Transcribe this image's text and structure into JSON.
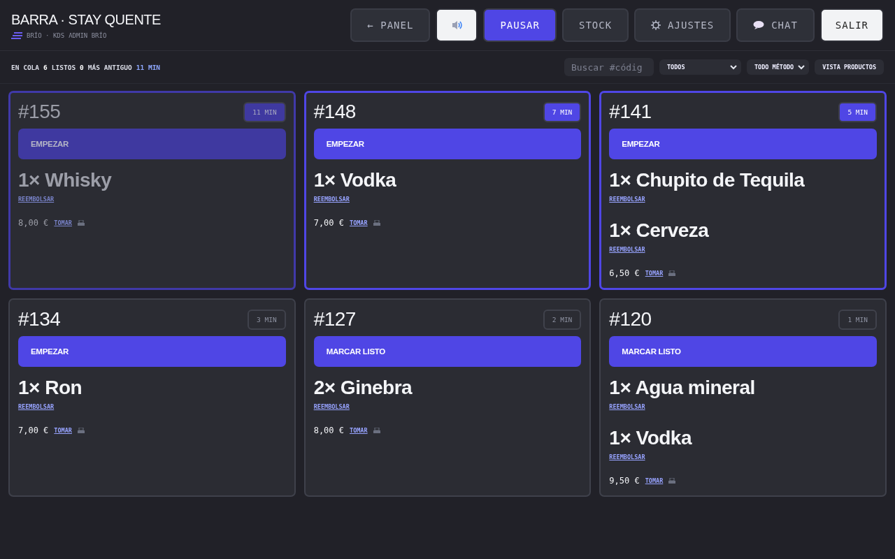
{
  "header": {
    "title": "BARRA · STAY QUENTE",
    "subtitle": "BRÍO · KDS",
    "user": "ADMIN BRÍO"
  },
  "buttons": [
    {
      "label": "← PANEL",
      "kind": "plain"
    },
    {
      "kind": "sound"
    },
    {
      "label": "PAUSAR",
      "kind": "primary"
    },
    {
      "label": "STOCK",
      "kind": "plain"
    },
    {
      "label": "AJUSTES",
      "kind": "settings"
    },
    {
      "label": "CHAT",
      "kind": "chat"
    },
    {
      "label": "SALIR",
      "kind": "exit"
    }
  ],
  "stats": [
    {
      "label": "EN COLA",
      "value": "6",
      "accent": false
    },
    {
      "label": "LISTOS",
      "value": "0",
      "accent": false
    },
    {
      "label": "MÁS ANTIGUO",
      "value": "11 MIN",
      "accent": true
    }
  ],
  "search": {
    "placeholder": "Buscar #códig"
  },
  "filters": [
    {
      "value": "TODOS",
      "wide": true
    },
    {
      "value": "TODO MÉTODO",
      "wide": false
    }
  ],
  "view_button": "VISTA PRODUCTOS",
  "orders": [
    {
      "number": "#155",
      "age": "11 MIN",
      "urgent": true,
      "dimmed": true,
      "action": "EMPEZAR",
      "items": [
        {
          "name": "1× Whisky",
          "refund": "REEMBOLSAR"
        }
      ],
      "total": "8,00 €",
      "take": "TOMAR"
    },
    {
      "number": "#148",
      "age": "7 MIN",
      "urgent": true,
      "dimmed": false,
      "action": "EMPEZAR",
      "items": [
        {
          "name": "1× Vodka",
          "refund": "REEMBOLSAR"
        }
      ],
      "total": "7,00 €",
      "take": "TOMAR"
    },
    {
      "number": "#141",
      "age": "5 MIN",
      "urgent": true,
      "dimmed": false,
      "action": "EMPEZAR",
      "items": [
        {
          "name": "1× Chupito de Tequila",
          "refund": "REEMBOLSAR"
        },
        {
          "name": "1× Cerveza",
          "refund": "REEMBOLSAR"
        }
      ],
      "total": "6,50 €",
      "take": "TOMAR"
    },
    {
      "number": "#134",
      "age": "3 MIN",
      "urgent": false,
      "dimmed": false,
      "action": "EMPEZAR",
      "items": [
        {
          "name": "1× Ron",
          "refund": "REEMBOLSAR"
        }
      ],
      "total": "7,00 €",
      "take": "TOMAR"
    },
    {
      "number": "#127",
      "age": "2 MIN",
      "urgent": false,
      "dimmed": false,
      "action": "MARCAR LISTO",
      "items": [
        {
          "name": "2× Ginebra",
          "refund": "REEMBOLSAR"
        }
      ],
      "total": "8,00 €",
      "take": "TOMAR"
    },
    {
      "number": "#120",
      "age": "1 MIN",
      "urgent": false,
      "dimmed": false,
      "action": "MARCAR LISTO",
      "items": [
        {
          "name": "1× Agua mineral",
          "refund": "REEMBOLSAR"
        },
        {
          "name": "1× Vodka",
          "refund": "REEMBOLSAR"
        }
      ],
      "total": "9,50 €",
      "take": "TOMAR"
    }
  ]
}
